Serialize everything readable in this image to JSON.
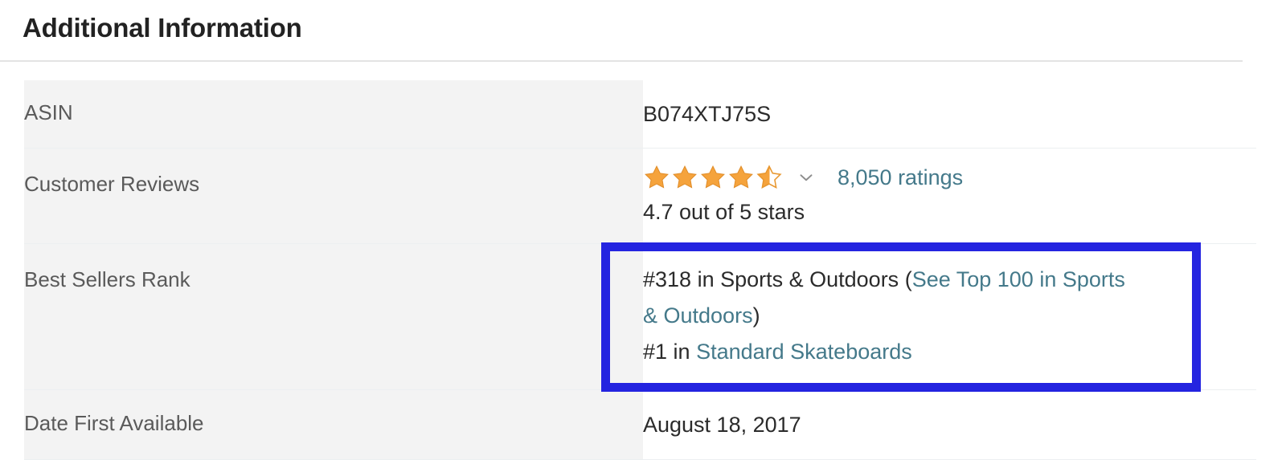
{
  "section": {
    "title": "Additional Information"
  },
  "table": {
    "rows": [
      {
        "label": "ASIN",
        "value": "B074XTJ75S"
      },
      {
        "label": "Customer Reviews",
        "rating_value": 4.7,
        "rating_max": 5,
        "stars_filled": 4,
        "stars_half": 1,
        "ratings_count_label": "8,050 ratings",
        "rating_text": "4.7 out of 5 stars",
        "dropdown_icon": "chevron-down-icon"
      },
      {
        "label": "Best Sellers Rank",
        "rank_primary_prefix": "#318 in Sports & Outdoors (",
        "rank_primary_link": "See Top 100 in Sports & Outdoors",
        "rank_primary_suffix": ")",
        "rank_secondary_prefix": "#1 in ",
        "rank_secondary_link": "Standard Skateboards"
      },
      {
        "label": "Date First Available",
        "value": "August 18, 2017"
      }
    ]
  },
  "annotation": {
    "name": "best-sellers-rank-highlight",
    "color": "#2424e0"
  },
  "colors": {
    "link": "#44798a",
    "star": "#f5a33c",
    "label_text": "#5a5a5a",
    "value_text": "#2b2b2b",
    "label_bg": "#f3f3f3",
    "row_border": "#eceff1",
    "highlight": "#2424e0"
  }
}
